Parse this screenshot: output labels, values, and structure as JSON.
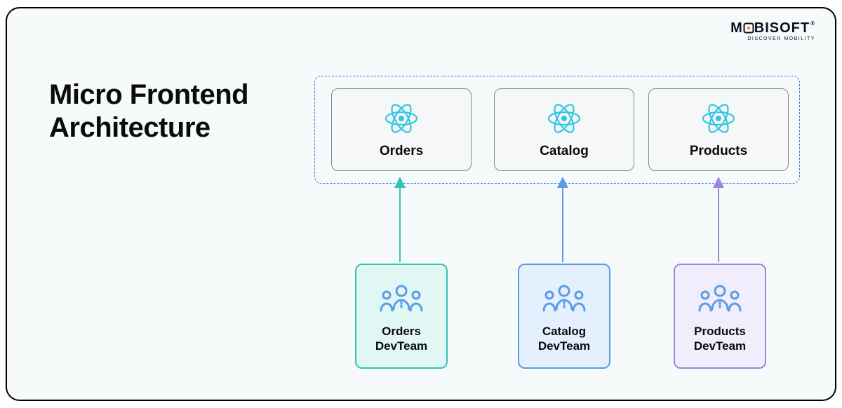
{
  "logo": {
    "brand_pre": "M",
    "brand_post": "BISOFT",
    "rmark": "®",
    "tagline": "DISCOVER MOBILITY"
  },
  "title_line1": "Micro Frontend",
  "title_line2": "Architecture",
  "microfrontends": [
    {
      "label": "Orders",
      "icon": "react-icon"
    },
    {
      "label": "Catalog",
      "icon": "react-icon"
    },
    {
      "label": "Products",
      "icon": "react-icon"
    }
  ],
  "teams": [
    {
      "label_line1": "Orders",
      "label_line2": "DevTeam",
      "icon": "team-icon",
      "accent": "#37c2b6"
    },
    {
      "label_line1": "Catalog",
      "label_line2": "DevTeam",
      "icon": "team-icon",
      "accent": "#5a9ce6"
    },
    {
      "label_line1": "Products",
      "label_line2": "DevTeam",
      "icon": "team-icon",
      "accent": "#9b88d6"
    }
  ],
  "icons": {
    "react_color": "#2fc8df",
    "team_color": "#5a9ce6"
  },
  "colors": {
    "container_dash": "#3f72e8",
    "arrow_teal": "#37c2b6",
    "arrow_blue": "#5a9ce6",
    "arrow_purple": "#9b88d6"
  }
}
